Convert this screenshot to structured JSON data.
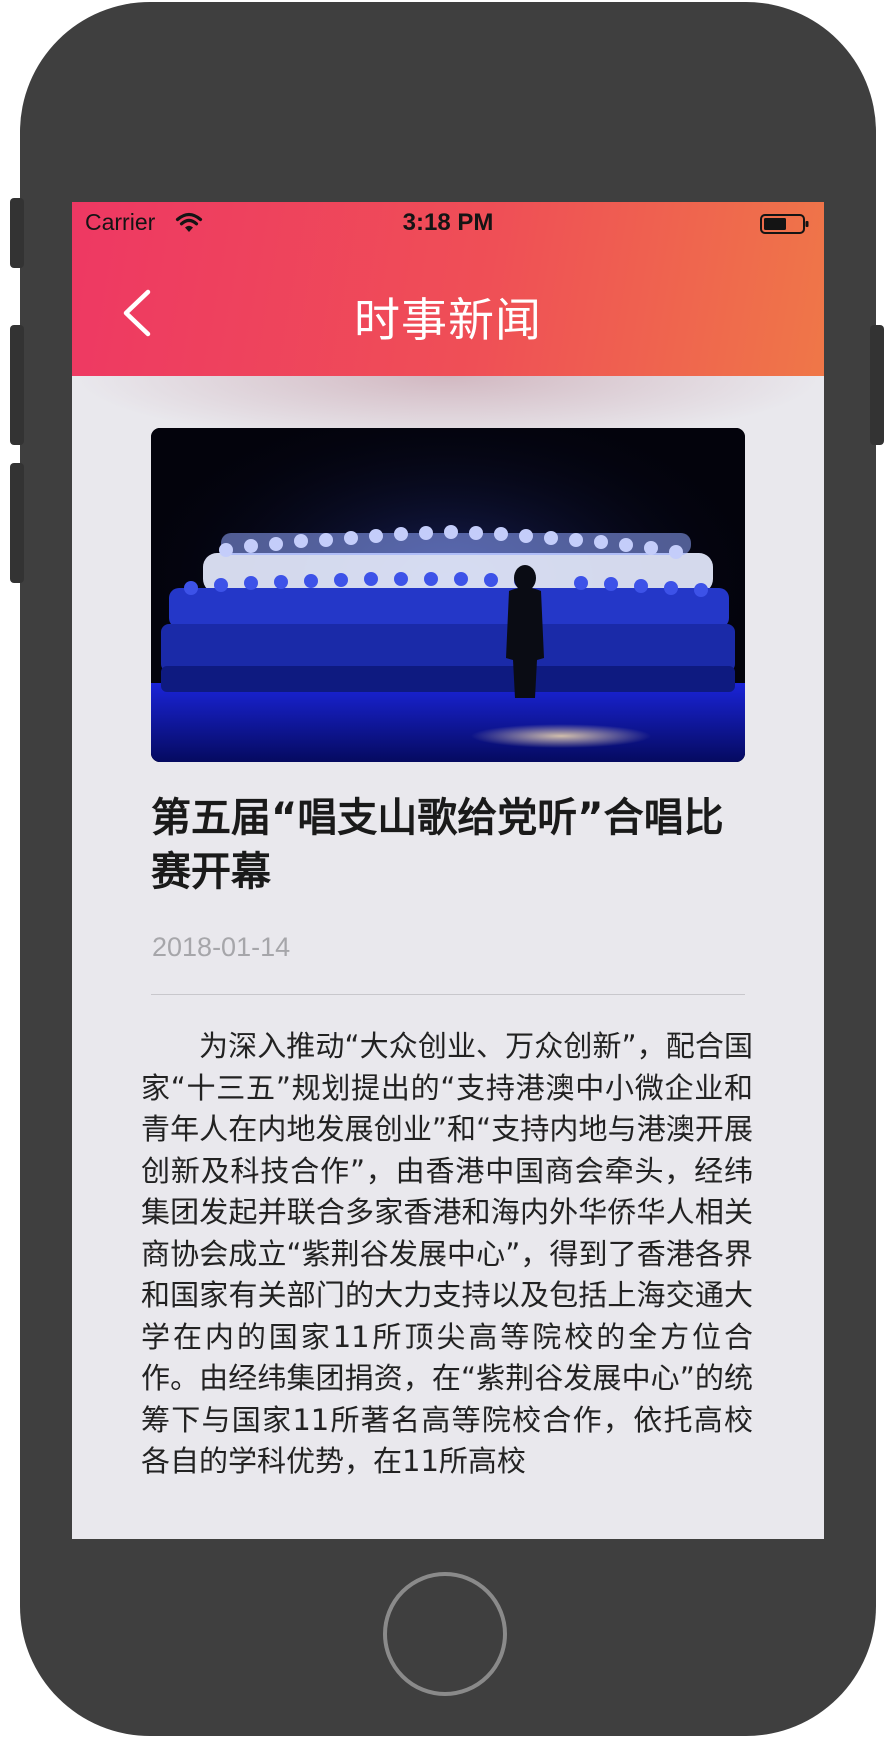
{
  "status_bar": {
    "carrier": "Carrier",
    "time": "3:18 PM",
    "wifi_icon": "wifi-icon",
    "battery_icon": "battery-icon"
  },
  "nav": {
    "back_icon": "chevron-left-icon",
    "title": "时事新闻"
  },
  "article": {
    "image": "choir-performance-photo",
    "title": "第五届“唱支山歌给党听”合唱比赛开幕",
    "date": "2018-01-14",
    "body": "为深入推动“大众创业、万众创新”，配合国家“十三五”规划提出的“支持港澳中小微企业和青年人在内地发展创业”和“支持内地与港澳开展创新及科技合作”，由香港中国商会牵头，经纬集团发起并联合多家香港和海内外华侨华人相关商协会成立“紫荆谷发展中心”，得到了香港各界和国家有关部门的大力支持以及包括上海交通大学在内的国家11所顶尖高等院校的全方位合作。由经纬集团捐资，在“紫荆谷发展中心”的统筹下与国家11所著名高等院校合作，依托高校各自的学科优势，在11所高校"
  },
  "colors": {
    "header_gradient_start": "#ee3863",
    "header_gradient_end": "#ef7748",
    "content_background": "#e9e8ed",
    "device_frame": "#3f3f3f",
    "date_text": "#a6a6aa"
  }
}
